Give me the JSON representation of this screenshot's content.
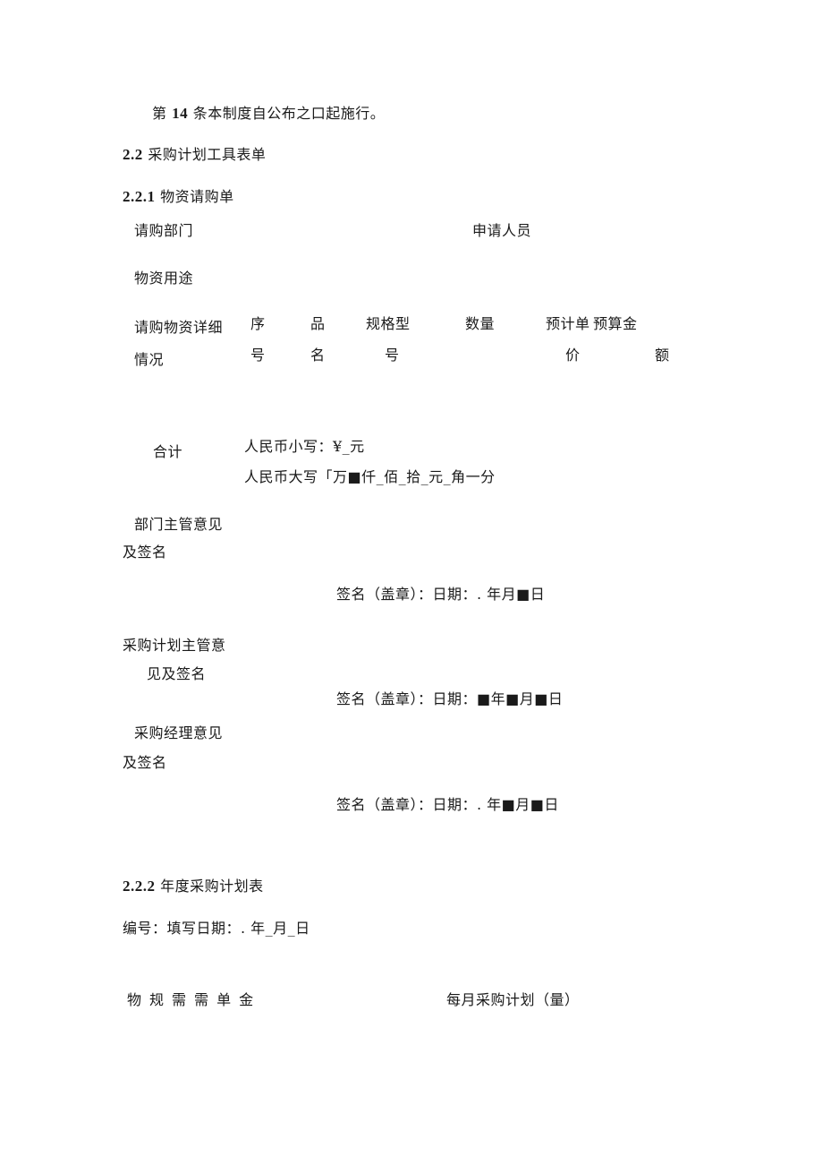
{
  "article14": {
    "prefix": "第",
    "number": "14",
    "text": "条本制度自公布之口起施行。"
  },
  "section_2_2": {
    "number": "2.2",
    "title": "采购计划工具表单"
  },
  "section_2_2_1": {
    "number": "2.2.1",
    "title": "物资请购单"
  },
  "requisition_form": {
    "dept_label": "请购部门",
    "applicant_label": "申请人员",
    "purpose_label": "物资用途",
    "detail_label_line1": "请购物资详细",
    "detail_label_line2": "情况",
    "columns": [
      {
        "line1": "序",
        "line2": "号"
      },
      {
        "line1": "品",
        "line2": "名"
      },
      {
        "line1": "规格型",
        "line2": "号"
      },
      {
        "line1": "数量",
        "line2": ""
      },
      {
        "line1": "预计单",
        "line2": "价"
      },
      {
        "line1": "预算金",
        "line2": "额"
      }
    ],
    "total_label": "合计",
    "rmb_lower": "人民币小写：¥_元",
    "rmb_upper": "人民币大写「万■仟_佰_拾_元_角一分",
    "approvals": [
      {
        "label_line1": "部门主管意见",
        "label_line2": "及签名",
        "signature": "签名（盖章）：日期：. 年月■日"
      },
      {
        "label_line1": "采购计划主管意",
        "label_line2": "见及签名",
        "signature": "签名（盖章）：日期：■年■月■日"
      },
      {
        "label_line1": "采购经理意见",
        "label_line2": "及签名",
        "signature": "签名（盖章）：日期：. 年■月■日"
      }
    ]
  },
  "section_2_2_2": {
    "number": "2.2.2",
    "title": "年度采购计划表"
  },
  "annual_plan": {
    "meta_line": "编号：填写日期：. 年_月_日",
    "header_columns": [
      "物",
      "规",
      "需",
      "需",
      "单",
      "金"
    ],
    "monthly_header": "每月采购计划（量）"
  }
}
